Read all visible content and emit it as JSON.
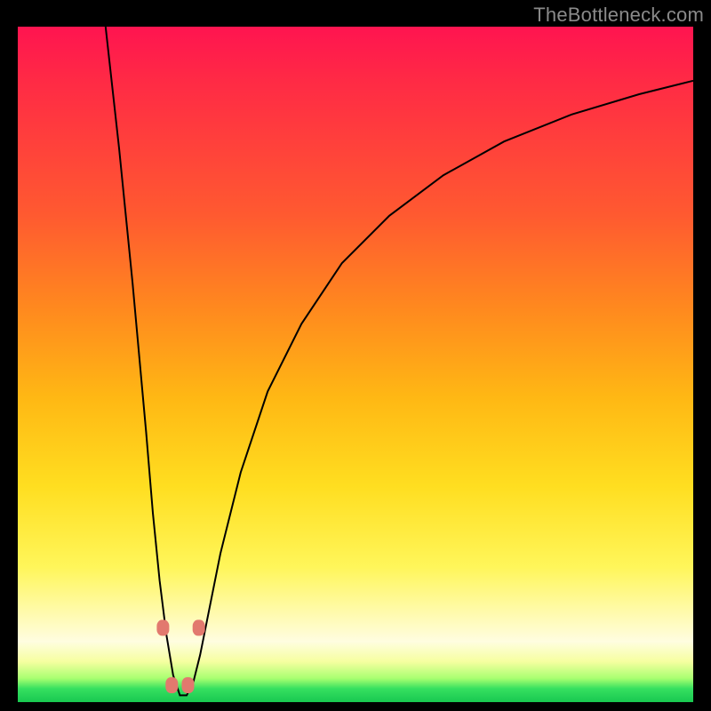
{
  "watermark": "TheBottleneck.com",
  "colors": {
    "background": "#000000",
    "curve": "#000000",
    "marker": "#e2796e",
    "gradient_top": "#ff1450",
    "gradient_bottom": "#18c850"
  },
  "chart_data": {
    "type": "line",
    "title": "",
    "xlabel": "",
    "ylabel": "",
    "xlim": [
      0,
      100
    ],
    "ylim": [
      0,
      100
    ],
    "note": "V-shaped bottleneck curve with minimum near x≈24; y represents bottleneck severity (higher = worse, red; lower = better, green). No tick labels shown in image; values are visual estimates on a 0–100 normalized scale.",
    "series": [
      {
        "name": "bottleneck-curve",
        "x": [
          13,
          15,
          17,
          19,
          20,
          21,
          22,
          23,
          24,
          25,
          26,
          27,
          28,
          30,
          33,
          37,
          42,
          48,
          55,
          63,
          72,
          82,
          92,
          100
        ],
        "y": [
          100,
          82,
          62,
          40,
          28,
          18,
          10,
          4,
          1,
          1,
          3,
          7,
          12,
          22,
          34,
          46,
          56,
          65,
          72,
          78,
          83,
          87,
          90,
          92
        ]
      }
    ],
    "markers": {
      "name": "highlight-points",
      "x": [
        21.5,
        22.8,
        25.2,
        26.8
      ],
      "y": [
        11.0,
        2.5,
        2.5,
        11.0
      ]
    }
  }
}
